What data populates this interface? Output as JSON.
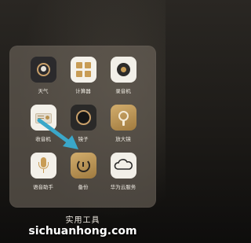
{
  "folder": {
    "title": "实用工具",
    "apps": [
      {
        "label": "天气",
        "icon": "weather-icon"
      },
      {
        "label": "计算器",
        "icon": "calculator-icon"
      },
      {
        "label": "录音机",
        "icon": "recorder-icon"
      },
      {
        "label": "收音机",
        "icon": "radio-icon"
      },
      {
        "label": "镜子",
        "icon": "mirror-icon"
      },
      {
        "label": "放大镜",
        "icon": "magnifier-icon"
      },
      {
        "label": "语音助手",
        "icon": "voice-assistant-icon"
      },
      {
        "label": "备份",
        "icon": "backup-icon"
      },
      {
        "label": "华为云服务",
        "icon": "cloud-service-icon"
      }
    ]
  },
  "watermark": "sichuanhong.com",
  "colors": {
    "arrow": "#3aa7c9",
    "gold": "#b8914e"
  }
}
